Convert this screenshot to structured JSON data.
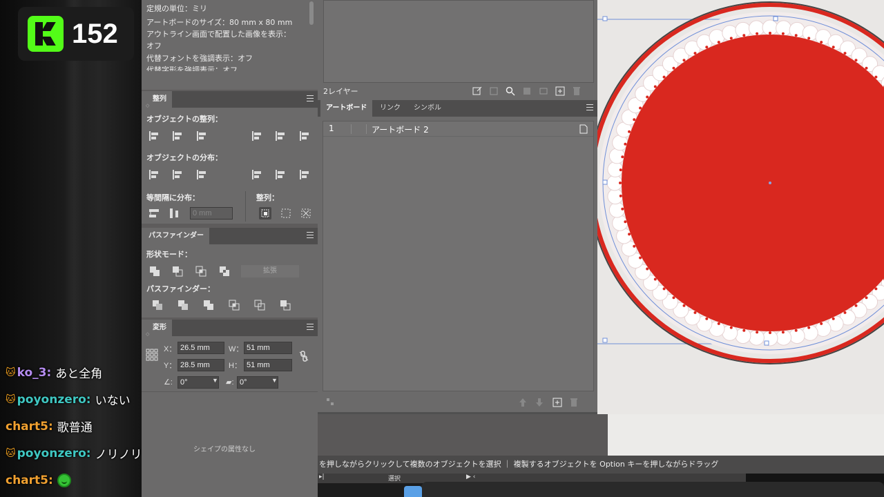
{
  "stream": {
    "viewer_count": "152",
    "logo_icon": "kick-logo-icon"
  },
  "chat": [
    {
      "badge": "🐱",
      "user": "ko_3:",
      "user_color": "#b58cf0",
      "message": "あと全角"
    },
    {
      "badge": "🐱",
      "user": "poyonzero:",
      "user_color": "#3fc7c2",
      "message": "いない"
    },
    {
      "badge": "",
      "user": "chart5:",
      "user_color": "#f0a030",
      "message": "歌普通"
    },
    {
      "badge": "🐱",
      "user": "poyonzero:",
      "user_color": "#3fc7c2",
      "message": "ノリノリ"
    },
    {
      "badge": "",
      "user": "chart5:",
      "user_color": "#f0a030",
      "message": "",
      "emote": "green-smile-emote"
    }
  ],
  "doc_info": {
    "lines": [
      "定規の単位：ミリ",
      "アートボードのサイズ：80 mm x 80 mm",
      "アウトライン画面で配置した画像を表示：",
      "オフ",
      "代替フォントを強調表示：オフ",
      "代替字形を強調表示：オフ"
    ]
  },
  "align": {
    "tab": "整列",
    "align_objects_label": "オブジェクトの整列：",
    "distribute_objects_label": "オブジェクトの分布：",
    "distribute_spacing_label": "等間隔に分布：",
    "spacing_value": "0 mm",
    "align_to_label": "整列："
  },
  "pathfinder": {
    "tab": "パスファインダー",
    "shape_modes_label": "形状モード：",
    "expand_label": "拡張",
    "pathfinders_label": "パスファインダー："
  },
  "transform": {
    "tab": "変形",
    "x_key": "X：",
    "x": "26.5 mm",
    "y_key": "Y：",
    "y": "28.5 mm",
    "w_key": "W：",
    "w": "51 mm",
    "h_key": "H：",
    "h": "51 mm",
    "rotate": "0°",
    "shear": "0°",
    "no_shape_props": "シェイプの属性なし"
  },
  "layers": {
    "count": "2レイヤー"
  },
  "artboards": {
    "tabs": [
      "アートボード",
      "リンク",
      "シンボル"
    ],
    "rows": [
      {
        "num": "1",
        "name": "アートボード 2"
      }
    ]
  },
  "status_bar": {
    "hint": "を押しながらクリックして複数のオブジェクトを選択 ｜ 複製するオブジェクトを Option キーを押しながらドラッグ",
    "tool": "選択"
  },
  "colors": {
    "fill_red": "#d9281f",
    "panel_bg": "#6b6a6a",
    "kick_green": "#53fc18"
  }
}
